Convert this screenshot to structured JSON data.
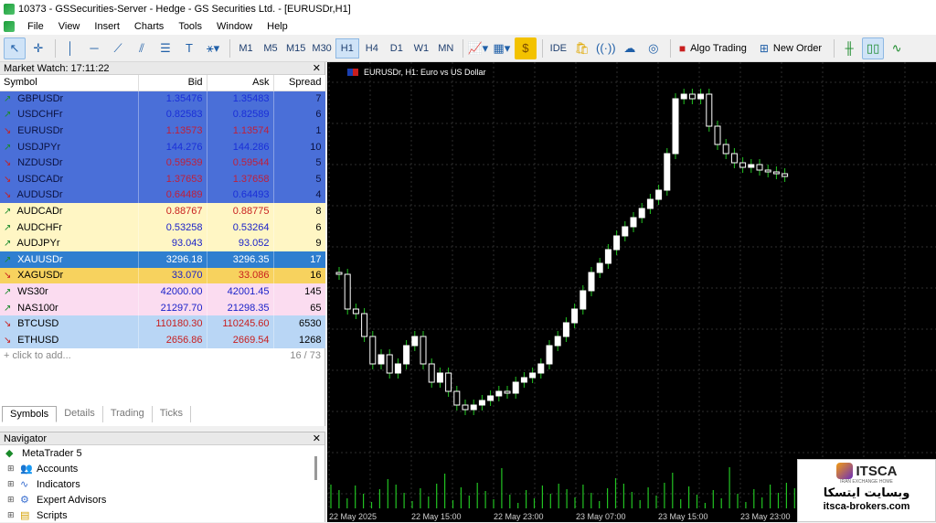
{
  "window": {
    "title": "10373 - GSSecurities-Server - Hedge - GS Securities Ltd. - [EURUSDr,H1]"
  },
  "menu": {
    "items": [
      "File",
      "View",
      "Insert",
      "Charts",
      "Tools",
      "Window",
      "Help"
    ]
  },
  "toolbar": {
    "timeframes": [
      "M1",
      "M5",
      "M15",
      "M30",
      "H1",
      "H4",
      "D1",
      "W1",
      "MN"
    ],
    "active_timeframe": "H1",
    "ide_label": "IDE",
    "algo_trading_label": "Algo Trading",
    "new_order_label": "New Order"
  },
  "market_watch": {
    "title": "Market Watch: 17:11:22",
    "columns": {
      "symbol": "Symbol",
      "bid": "Bid",
      "ask": "Ask",
      "spread": "Spread"
    },
    "rows": [
      {
        "symbol": "GBPUSDr",
        "bid": "1.35476",
        "ask": "1.35483",
        "spread": "7",
        "dir": "up",
        "style": "blue",
        "bidc": "pb",
        "askc": "pb"
      },
      {
        "symbol": "USDCHFr",
        "bid": "0.82583",
        "ask": "0.82589",
        "spread": "6",
        "dir": "up",
        "style": "blue",
        "bidc": "pb",
        "askc": "pb"
      },
      {
        "symbol": "EURUSDr",
        "bid": "1.13573",
        "ask": "1.13574",
        "spread": "1",
        "dir": "dn",
        "style": "blue",
        "bidc": "pr",
        "askc": "pr"
      },
      {
        "symbol": "USDJPYr",
        "bid": "144.276",
        "ask": "144.286",
        "spread": "10",
        "dir": "up",
        "style": "blue",
        "bidc": "pb",
        "askc": "pb"
      },
      {
        "symbol": "NZDUSDr",
        "bid": "0.59539",
        "ask": "0.59544",
        "spread": "5",
        "dir": "dn",
        "style": "blue",
        "bidc": "pr",
        "askc": "pr"
      },
      {
        "symbol": "USDCADr",
        "bid": "1.37653",
        "ask": "1.37658",
        "spread": "5",
        "dir": "dn",
        "style": "blue",
        "bidc": "pr",
        "askc": "pr"
      },
      {
        "symbol": "AUDUSDr",
        "bid": "0.64489",
        "ask": "0.64493",
        "spread": "4",
        "dir": "dn",
        "style": "blue",
        "bidc": "pr",
        "askc": "pb"
      },
      {
        "symbol": "AUDCADr",
        "bid": "0.88767",
        "ask": "0.88775",
        "spread": "8",
        "dir": "up",
        "style": "yellow",
        "bidc": "pr",
        "askc": "pr"
      },
      {
        "symbol": "AUDCHFr",
        "bid": "0.53258",
        "ask": "0.53264",
        "spread": "6",
        "dir": "up",
        "style": "yellow",
        "bidc": "pb",
        "askc": "pb"
      },
      {
        "symbol": "AUDJPYr",
        "bid": "93.043",
        "ask": "93.052",
        "spread": "9",
        "dir": "up",
        "style": "yellow",
        "bidc": "pb",
        "askc": "pb"
      },
      {
        "symbol": "XAUUSDr",
        "bid": "3296.18",
        "ask": "3296.35",
        "spread": "17",
        "dir": "up",
        "style": "sel",
        "bidc": "",
        "askc": ""
      },
      {
        "symbol": "XAGUSDr",
        "bid": "33.070",
        "ask": "33.086",
        "spread": "16",
        "dir": "dn",
        "style": "gold",
        "bidc": "pb",
        "askc": "pr"
      },
      {
        "symbol": "WS30r",
        "bid": "42000.00",
        "ask": "42001.45",
        "spread": "145",
        "dir": "up",
        "style": "pink",
        "bidc": "pb",
        "askc": "pb"
      },
      {
        "symbol": "NAS100r",
        "bid": "21297.70",
        "ask": "21298.35",
        "spread": "65",
        "dir": "up",
        "style": "pink",
        "bidc": "pb",
        "askc": "pb"
      },
      {
        "symbol": "BTCUSD",
        "bid": "110180.30",
        "ask": "110245.60",
        "spread": "6530",
        "dir": "dn",
        "style": "lblue",
        "bidc": "pr",
        "askc": "pr"
      },
      {
        "symbol": "ETHUSD",
        "bid": "2656.86",
        "ask": "2669.54",
        "spread": "1268",
        "dir": "dn",
        "style": "lblue",
        "bidc": "pr",
        "askc": "pr"
      }
    ],
    "add_label": "click to add...",
    "count": "16 / 73",
    "tabs": [
      "Symbols",
      "Details",
      "Trading",
      "Ticks"
    ],
    "active_tab": "Symbols"
  },
  "navigator": {
    "title": "Navigator",
    "root": "MetaTrader 5",
    "items": [
      "Accounts",
      "Indicators",
      "Expert Advisors",
      "Scripts"
    ]
  },
  "chart": {
    "title": "EURUSDr, H1:  Euro vs US Dollar",
    "time_labels": [
      "22 May 2025",
      "22 May 15:00",
      "22 May 23:00",
      "23 May 07:00",
      "23 May 15:00",
      "23 May 23:00"
    ]
  },
  "badge": {
    "brand": "ITSCA",
    "sub": "IRAN EXCHANGE HOME",
    "fa_text": "وبسایت ایتسکا",
    "url": "itsca-brokers.com"
  },
  "colors": {
    "chart_bg": "#000000",
    "candle_up": "#ffffff",
    "candle_down": "#000000",
    "wick": "#22c322",
    "grid": "#2e2e2e",
    "volume": "#22c322"
  }
}
